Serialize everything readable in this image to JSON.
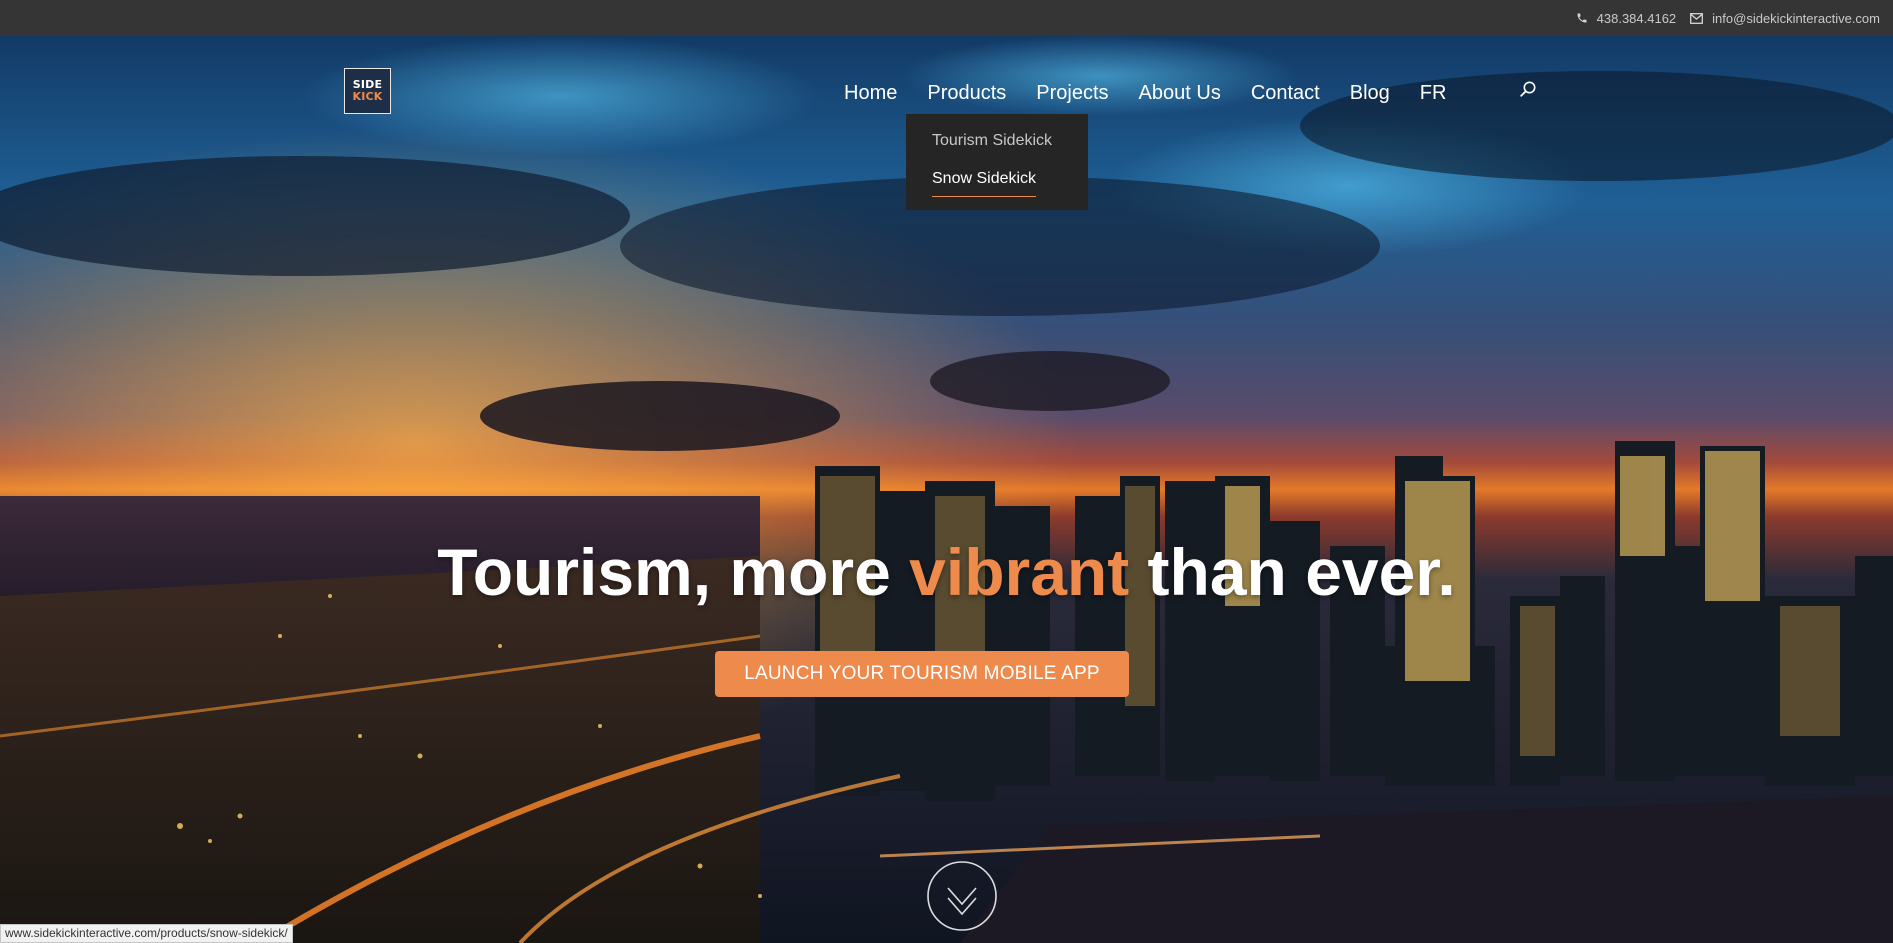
{
  "topbar": {
    "phone": "438.384.4162",
    "email": "info@sidekickinteractive.com",
    "phone_icon": "phone-icon",
    "email_icon": "envelope-icon"
  },
  "logo": {
    "line1": "SIDE",
    "line2": "KICK"
  },
  "nav": {
    "items": [
      "Home",
      "Products",
      "Projects",
      "About Us",
      "Contact",
      "Blog",
      "FR"
    ],
    "active": "Products",
    "search_icon": "search-icon"
  },
  "dropdown": {
    "items": [
      "Tourism Sidekick",
      "Snow Sidekick"
    ],
    "hovered": "Snow Sidekick"
  },
  "hero": {
    "headline_before": "Tourism, more ",
    "headline_accent": "vibrant",
    "headline_after": " than ever.",
    "cta": "LAUNCH YOUR TOURISM MOBILE APP",
    "scroll_icon": "chevron-down-icon"
  },
  "status_url": "www.sidekickinteractive.com/products/snow-sidekick/",
  "colors": {
    "accent": "#ef8a4d",
    "topbar": "#353535",
    "dropdown": "#252525"
  }
}
